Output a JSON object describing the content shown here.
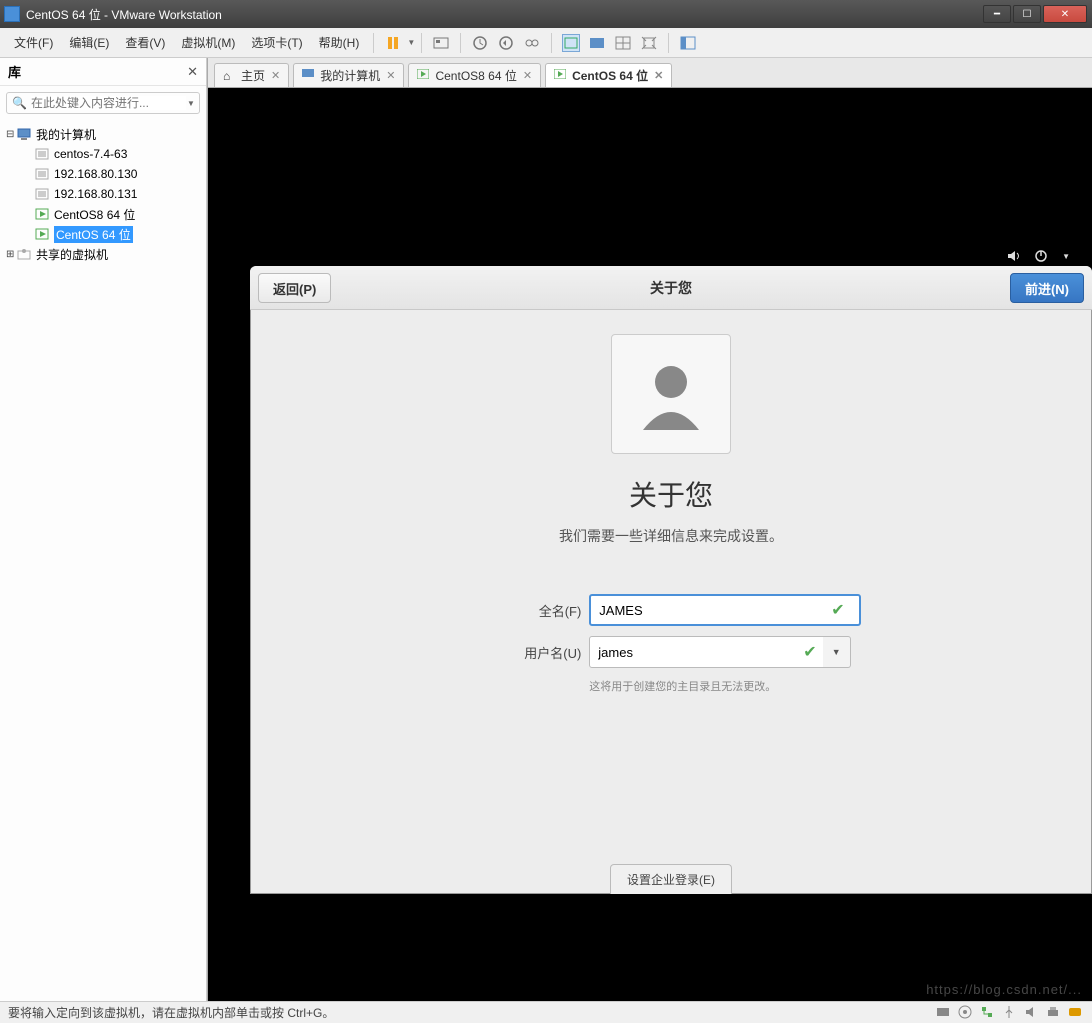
{
  "window": {
    "title": "CentOS 64 位 - VMware Workstation"
  },
  "menu": {
    "file": "文件(F)",
    "edit": "编辑(E)",
    "view": "查看(V)",
    "vm": "虚拟机(M)",
    "tabs": "选项卡(T)",
    "help": "帮助(H)"
  },
  "sidebar": {
    "title": "库",
    "search_placeholder": "在此处键入内容进行...",
    "root": "我的计算机",
    "items": [
      "centos-7.4-63",
      "192.168.80.130",
      "192.168.80.131",
      "CentOS8 64 位",
      "CentOS 64 位"
    ],
    "shared": "共享的虚拟机"
  },
  "tabs": {
    "home": "主页",
    "mycomputer": "我的计算机",
    "centos8": "CentOS8 64 位",
    "centos": "CentOS 64 位"
  },
  "gnome": {
    "back": "返回(P)",
    "forward": "前进(N)",
    "header_title": "关于您",
    "title": "关于您",
    "subtitle": "我们需要一些详细信息来完成设置。",
    "fullname_label": "全名(F)",
    "fullname_value": "JAMES",
    "username_label": "用户名(U)",
    "username_value": "james",
    "hint": "这将用于创建您的主目录且无法更改。",
    "enterprise": "设置企业登录(E)"
  },
  "statusbar": {
    "text": "要将输入定向到该虚拟机，请在虚拟机内部单击或按 Ctrl+G。"
  },
  "watermark": "https://blog.csdn.net/..."
}
